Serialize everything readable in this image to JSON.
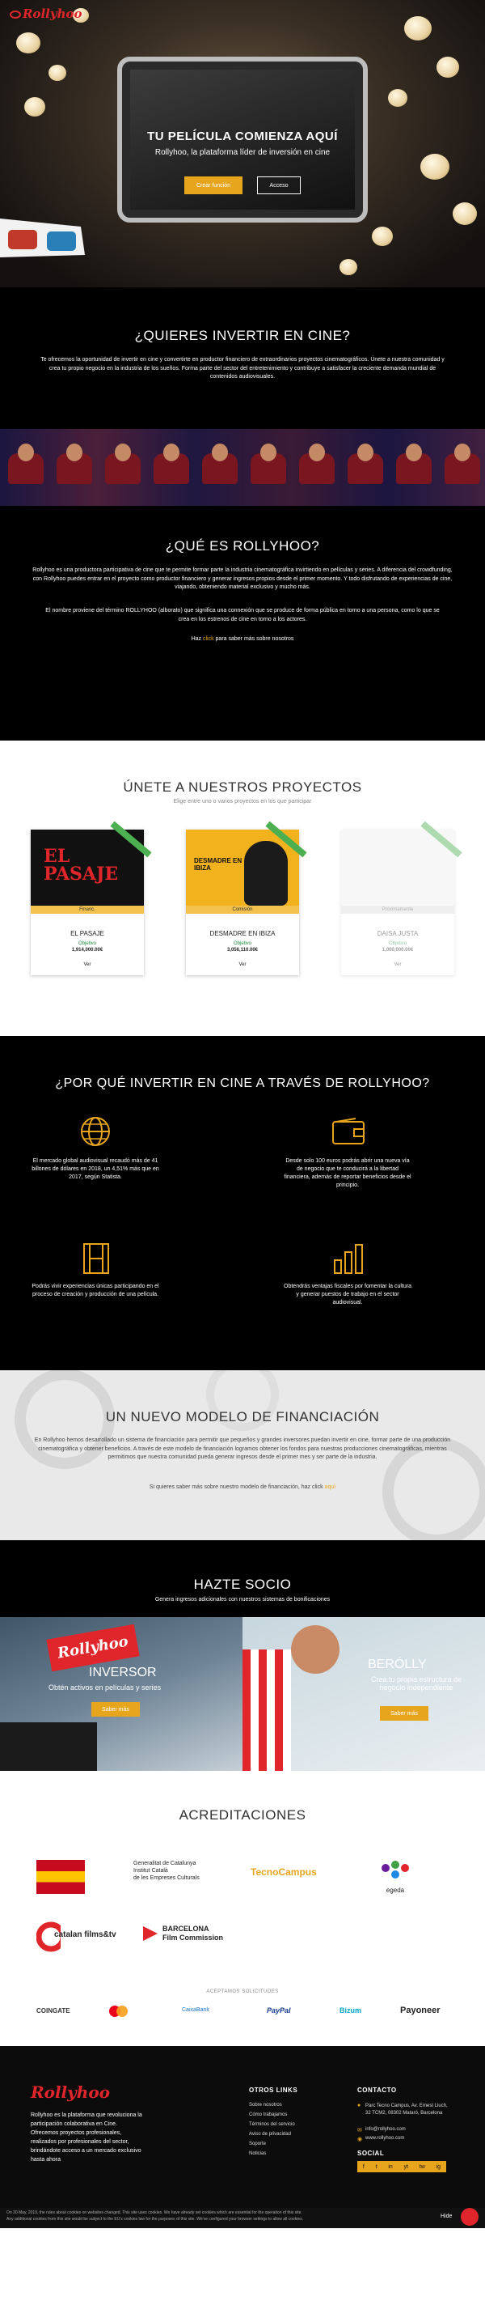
{
  "brand": {
    "name": "Rollyhoo",
    "red": "#e0262b",
    "gold": "#e7a51e"
  },
  "hero": {
    "title": "TU PELÍCULA COMIENZA AQUÍ",
    "subtitle": "Rollyhoo, la plataforma líder de inversión en cine",
    "primary": "Crear función",
    "secondary": "Acceso"
  },
  "invest": {
    "title": "¿QUIERES INVERTIR EN CINE?",
    "text": "Te ofrecemos la oportunidad de invertir en cine y convertirte en productor financiero de extraordinarios proyectos cinematográficos. Únete a nuestra comunidad y crea tu propio negocio en la industria de los sueños. Forma parte del sector del entretenimiento y contribuye a satisfacer la creciente demanda mundial de contenidos audiovisuales."
  },
  "about": {
    "title": "¿QUÉ ES ROLLYHOO?",
    "p1": "Rollyhoo es una productora participativa de cine que te permite formar parte la industria cinematográfica invirtiendo en películas y series. A diferencia del crowdfunding, con Rollyhoo puedes entrar en el proyecto como productor financiero y generar ingresos propios desde el primer momento. Y todo disfrutando de experiencias de cine, viajando, obteniendo material exclusivo y mucho más.",
    "p2": "El nombre proviene del término ROLLYHOO (alborato) que significa una connexión que se produce de forma pública en torno a una persona, como lo que se crea en los estrenos de cine en torno a los actores.",
    "more_prefix": "Haz ",
    "more_link": "click",
    "more_suffix": " para saber más sobre nosotros"
  },
  "projects": {
    "title": "ÚNETE A NUESTROS PROYECTOS",
    "subtitle": "Elige entre uno o varios proyectos en los que participar",
    "items": [
      {
        "title": "EL PASAJE",
        "status": "Financ.",
        "objective": "Objetivo",
        "amount": "1,914,000.00€",
        "cta": "Ver",
        "image_text": "EL PASAJE"
      },
      {
        "title": "DESMADRE EN IBIZA",
        "status": "Comisión",
        "objective": "Objetivo",
        "amount": "3,056,110.00€",
        "cta": "Ver",
        "image_text": "DESMADRE EN IBIZA"
      },
      {
        "title": "DAISA JUSTA",
        "status": "Próximamente",
        "objective": "Objetivo",
        "amount": "1,000,000.00€",
        "cta": "Ver",
        "image_text": ""
      }
    ]
  },
  "why": {
    "title": "¿POR QUÉ INVERTIR EN CINE A TRAVÉS DE ROLLYHOO?",
    "features": [
      {
        "icon": "globe-icon",
        "text": "El mercado global audiovisual recaudó más de 41 billones de dólares en 2018, un 4,51% más que en 2017, según Statista."
      },
      {
        "icon": "wallet-icon",
        "text": "Desde solo 100 euros podrás abrir una nueva vía de negocio que te conducirá a la libertad financiera, además de reportar beneficios desde el principio."
      },
      {
        "icon": "film-icon",
        "text": "Podrás vivir experiencias únicas participando en el proceso de creación y producción de una película."
      },
      {
        "icon": "bar-chart-icon",
        "text": "Obtendrás ventajas fiscales por fomentar la cultura y generar puestos de trabajo en el sector audiovisual."
      }
    ]
  },
  "model": {
    "title": "UN NUEVO MODELO DE FINANCIACIÓN",
    "text": "En Rollyhoo hemos desarrollado un sistema de financiación para permitir que pequeños y grandes inversores puedan invertir en cine, formar parte de una producción cinematográfica y obtener beneficios. A través de este modelo de financiación logramos obtener los fondos para nuestras producciones cinematográficas, mientras permitimos que nuestra comunidad pueda generar ingresos desde el primer mes y ser parte de la industria.",
    "more_prefix": "Si quieres saber más sobre nuestro modelo de financiación, haz click ",
    "more_link": "aquí"
  },
  "socio": {
    "title": "HAZTE SOCIO",
    "subtitle": "Genera ingresos adicionales con nuestros sistemas de bonificaciones",
    "left": {
      "brand": "Rollyhoo",
      "title": "INVERSOR",
      "text": "Obtén activos en películas y series",
      "cta": "Saber más"
    },
    "right": {
      "title": "BERÓLLY",
      "text": "Crea tu propia estructura de negocio independiente",
      "cta": "Saber más"
    }
  },
  "acreditaciones": {
    "title": "ACREDITACIONES",
    "logos": [
      {
        "name": "gobierno-espana",
        "text": ""
      },
      {
        "name": "generalitat",
        "text": "Generalitat de Catalunya\nInstitut Català\nde les Empreses Culturals"
      },
      {
        "name": "tecnocampus",
        "text": "TecnoCampus"
      },
      {
        "name": "egeda",
        "text": "egeda"
      },
      {
        "name": "catalan-films",
        "text": "catalan films&tv"
      },
      {
        "name": "barcelona-film",
        "text": "BARCELONA\nFilm Commission"
      }
    ],
    "payments_title": "ACEPTAMOS SOLICITUDES",
    "payments": [
      "COINGATE",
      "Mastercard",
      "CaixaBank",
      "PayPal",
      "Bizum",
      "Payoneer"
    ]
  },
  "footer": {
    "brand": "Rollyhoo",
    "about": "Rollyhoo es la plataforma que revoluciona la participación colaborativa en Cine. Ofrecemos proyectos profesionales, realizados por profesionales del sector, brindándote acceso a un mercado exclusivo hasta ahora",
    "links_title": "OTROS LINKS",
    "links": [
      "Sobre nosotros",
      "Cómo trabajamos",
      "Términos del servicio",
      "Aviso de privacidad",
      "Soporte",
      "Noticias"
    ],
    "contact_title": "CONTACTO",
    "address": "Parc Tecno Campus, Av. Ernest Lluch, 32 TCM2, 08302 Mataró, Barcelona",
    "email": "info@rollyhoo.com",
    "web": "www.rollyhoo.com",
    "social_title": "SOCIAL",
    "social": [
      "f",
      "t",
      "in",
      "yt",
      "tw",
      "ig"
    ]
  },
  "cookies": {
    "text": "On 30 May, 2019, the rules about cookies on websites changed. This site uses cookies. We have already set cookies which are essential for the operation of this site.",
    "note": "Any additional cookies from this site would be subject to the EU's cookies law for the purposes of this site. We've configured your browser settings to allow all cookies.",
    "hide": "Hide"
  }
}
